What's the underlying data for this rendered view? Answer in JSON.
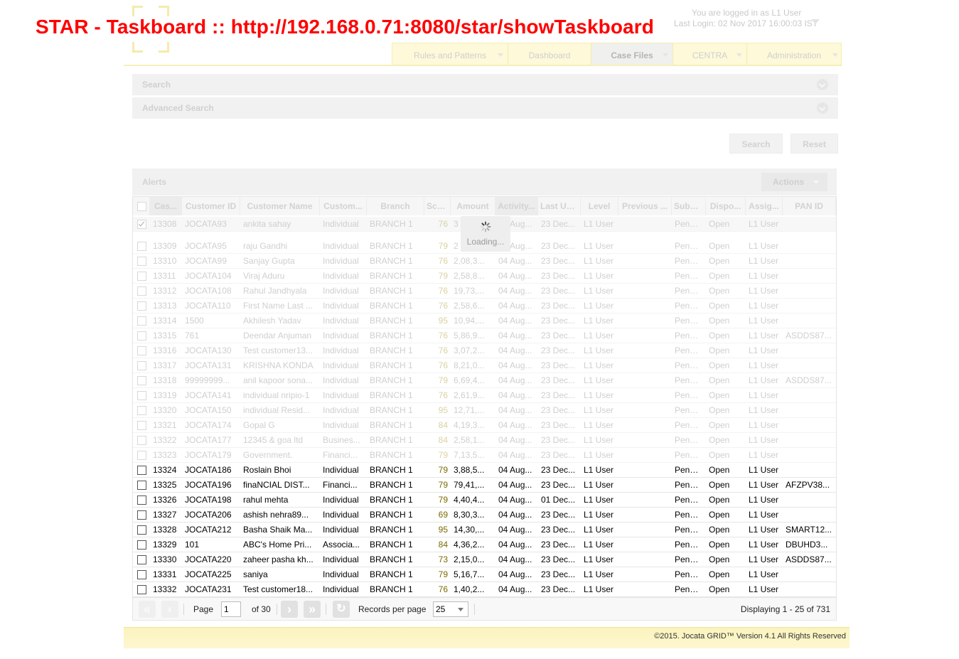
{
  "overlay_title": "STAR - Taskboard :: http://192.168.0.71:8080/star/showTaskboard",
  "login": {
    "line1": "You are logged in as L1 User",
    "line2": "Last Login: 02 Nov 2017 16:00:03 IST"
  },
  "nav": {
    "tabs": [
      {
        "label": "Rules and Patterns",
        "active": false,
        "has_menu": true
      },
      {
        "label": "Dashboard",
        "active": false,
        "has_menu": false
      },
      {
        "label": "Case Files",
        "active": true,
        "has_menu": true
      },
      {
        "label": "CENTRA",
        "active": false,
        "has_menu": true
      },
      {
        "label": "Administration",
        "active": false,
        "has_menu": true
      }
    ]
  },
  "panels": {
    "search": "Search",
    "advanced_search": "Advanced Search"
  },
  "buttons": {
    "search": "Search",
    "reset": "Reset",
    "actions": "Actions"
  },
  "alerts": {
    "title": "Alerts",
    "columns": [
      "Cas...",
      "Customer ID",
      "Customer Name",
      "Custom...",
      "Branch",
      "Score",
      "Amount",
      "Activity...",
      "Last Up...",
      "Level",
      "Previous ...",
      "Subst...",
      "Dispo...",
      "Assig...",
      "PAN ID"
    ],
    "rows": [
      [
        "13308",
        "JOCATA93",
        "ankita sahay",
        "Individual",
        "BRANCH 1",
        "76",
        "3",
        "04 Aug...",
        "23 Dec...",
        "L1 User",
        "",
        "Pendi...",
        "Open",
        "L1 User",
        ""
      ],
      [
        "13309",
        "JOCATA95",
        "raju Gandhi",
        "Individual",
        "BRANCH 1",
        "79",
        "2",
        "04 Aug...",
        "23 Dec...",
        "L1 User",
        "",
        "Pendi...",
        "Open",
        "L1 User",
        ""
      ],
      [
        "13310",
        "JOCATA99",
        "Sanjay Gupta",
        "Individual",
        "BRANCH 1",
        "76",
        "2,08,3...",
        "04 Aug...",
        "23 Dec...",
        "L1 User",
        "",
        "Pendi...",
        "Open",
        "L1 User",
        ""
      ],
      [
        "13311",
        "JOCATA104",
        "Viraj Aduru",
        "Individual",
        "BRANCH 1",
        "79",
        "2,58,8...",
        "04 Aug...",
        "23 Dec...",
        "L1 User",
        "",
        "Pendi...",
        "Open",
        "L1 User",
        ""
      ],
      [
        "13312",
        "JOCATA108",
        "Rahul Jandhyala",
        "Individual",
        "BRANCH 1",
        "76",
        "19,73,...",
        "04 Aug...",
        "23 Dec...",
        "L1 User",
        "",
        "Pendi...",
        "Open",
        "L1 User",
        ""
      ],
      [
        "13313",
        "JOCATA110",
        "First Name Last ...",
        "Individual",
        "BRANCH 1",
        "76",
        "2,58,6...",
        "04 Aug...",
        "23 Dec...",
        "L1 User",
        "",
        "Pendi...",
        "Open",
        "L1 User",
        ""
      ],
      [
        "13314",
        "1500",
        "Akhilesh Yadav",
        "Individual",
        "BRANCH 1",
        "95",
        "10,94,...",
        "04 Aug...",
        "23 Dec...",
        "L1 User",
        "",
        "Pendi...",
        "Open",
        "L1 User",
        ""
      ],
      [
        "13315",
        "761",
        "Deendar Anjuman",
        "Individual",
        "BRANCH 1",
        "76",
        "5,86,9...",
        "04 Aug...",
        "23 Dec...",
        "L1 User",
        "",
        "Pendi...",
        "Open",
        "L1 User",
        "ASDDS87..."
      ],
      [
        "13316",
        "JOCATA130",
        "Test customer13...",
        "Individual",
        "BRANCH 1",
        "76",
        "3,07,2...",
        "04 Aug...",
        "23 Dec...",
        "L1 User",
        "",
        "Pendi...",
        "Open",
        "L1 User",
        ""
      ],
      [
        "13317",
        "JOCATA131",
        "KRISHNA KONDA",
        "Individual",
        "BRANCH 1",
        "76",
        "8,21,0...",
        "04 Aug...",
        "23 Dec...",
        "L1 User",
        "",
        "Pendi...",
        "Open",
        "L1 User",
        ""
      ],
      [
        "13318",
        "99999999...",
        "anil kapoor sona...",
        "Individual",
        "BRANCH 1",
        "79",
        "6,69,4...",
        "04 Aug...",
        "23 Dec...",
        "L1 User",
        "",
        "Pendi...",
        "Open",
        "L1 User",
        "ASDDS87..."
      ],
      [
        "13319",
        "JOCATA141",
        "individual nripio-1",
        "Individual",
        "BRANCH 1",
        "76",
        "2,61,9...",
        "04 Aug...",
        "23 Dec...",
        "L1 User",
        "",
        "Pendi...",
        "Open",
        "L1 User",
        ""
      ],
      [
        "13320",
        "JOCATA150",
        "individual Resid...",
        "Individual",
        "BRANCH 1",
        "95",
        "12,71,...",
        "04 Aug...",
        "23 Dec...",
        "L1 User",
        "",
        "Pendi...",
        "Open",
        "L1 User",
        ""
      ],
      [
        "13321",
        "JOCATA174",
        "Gopal G",
        "Individual",
        "BRANCH 1",
        "84",
        "4,19,3...",
        "04 Aug...",
        "23 Dec...",
        "L1 User",
        "",
        "Pendi...",
        "Open",
        "L1 User",
        ""
      ],
      [
        "13322",
        "JOCATA177",
        "12345 & goa ltd",
        "Busines...",
        "BRANCH 1",
        "84",
        "2,58,1...",
        "04 Aug...",
        "23 Dec...",
        "L1 User",
        "",
        "Pendi...",
        "Open",
        "L1 User",
        ""
      ],
      [
        "13323",
        "JOCATA179",
        "Government.",
        "Financi...",
        "BRANCH 1",
        "79",
        "7,13,5...",
        "04 Aug...",
        "23 Dec...",
        "L1 User",
        "",
        "Pendi...",
        "Open",
        "L1 User",
        ""
      ],
      [
        "13324",
        "JOCATA186",
        "Roslain Bhoi",
        "Individual",
        "BRANCH 1",
        "79",
        "3,88,5...",
        "04 Aug...",
        "23 Dec...",
        "L1 User",
        "",
        "Pendi...",
        "Open",
        "L1 User",
        ""
      ],
      [
        "13325",
        "JOCATA196",
        "finaNCIAL DIST...",
        "Financi...",
        "BRANCH 1",
        "79",
        "79,41,...",
        "04 Aug...",
        "23 Dec...",
        "L1 User",
        "",
        "Pendi...",
        "Open",
        "L1 User",
        "AFZPV38..."
      ],
      [
        "13326",
        "JOCATA198",
        "rahul mehta",
        "Individual",
        "BRANCH 1",
        "79",
        "4,40,4...",
        "04 Aug...",
        "01 Dec...",
        "L1 User",
        "",
        "Pendi...",
        "Open",
        "L1 User",
        ""
      ],
      [
        "13327",
        "JOCATA206",
        "ashish nehra89...",
        "Individual",
        "BRANCH 1",
        "69",
        "8,30,3...",
        "04 Aug...",
        "23 Dec...",
        "L1 User",
        "",
        "Pendi...",
        "Open",
        "L1 User",
        ""
      ],
      [
        "13328",
        "JOCATA212",
        "Basha Shaik Ma...",
        "Individual",
        "BRANCH 1",
        "95",
        "14,30,...",
        "04 Aug...",
        "23 Dec...",
        "L1 User",
        "",
        "Pendi...",
        "Open",
        "L1 User",
        "SMART12..."
      ],
      [
        "13329",
        "101",
        "ABC's Home Pri...",
        "Associa...",
        "BRANCH 1",
        "84",
        "4,36,2...",
        "04 Aug...",
        "23 Dec...",
        "L1 User",
        "",
        "Pendi...",
        "Open",
        "L1 User",
        "DBUHD3..."
      ],
      [
        "13330",
        "JOCATA220",
        "zaheer pasha kh...",
        "Individual",
        "BRANCH 1",
        "73",
        "2,15,0...",
        "04 Aug...",
        "23 Dec...",
        "L1 User",
        "",
        "Pendi...",
        "Open",
        "L1 User",
        "ASDDS87..."
      ],
      [
        "13331",
        "JOCATA225",
        "saniya",
        "Individual",
        "BRANCH 1",
        "79",
        "5,16,7...",
        "04 Aug...",
        "23 Dec...",
        "L1 User",
        "",
        "Pendi...",
        "Open",
        "L1 User",
        ""
      ],
      [
        "13332",
        "JOCATA231",
        "Test customer18...",
        "Individual",
        "BRANCH 1",
        "76",
        "1,40,2...",
        "04 Aug...",
        "23 Dec...",
        "L1 User",
        "",
        "Pendi...",
        "Open",
        "L1 User",
        ""
      ]
    ],
    "faded_row_count": 16,
    "checked_row_index": 0
  },
  "loading_text": "Loading...",
  "pager": {
    "page_label": "Page",
    "page_value": "1",
    "of_label": "of 30",
    "rpp_label": "Records per page",
    "rpp_value": "25",
    "display_text": "Displaying 1 - 25 of 731"
  },
  "footer": "©2015. Jocata GRID™ Version 4.1 All Rights Reserved",
  "colors": {
    "title_red": "#ff0000",
    "nav_bg": "#fdf9d9",
    "footer_bg": "#fbf3bd"
  }
}
